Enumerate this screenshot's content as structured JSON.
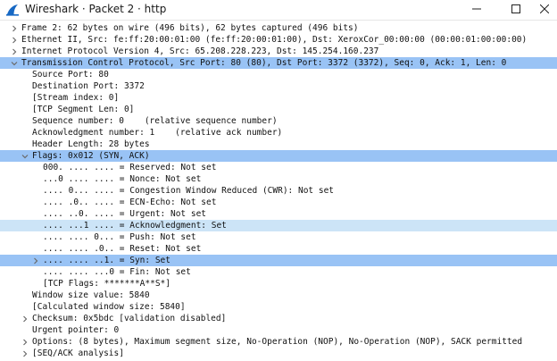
{
  "window": {
    "title": "Wireshark · Packet 2 · http",
    "controls": {
      "minimize": "–",
      "maximize": "□",
      "close": "✕"
    }
  },
  "colors": {
    "selected_row": "#99c3f5",
    "hover_row": "#cce4f7",
    "expander": "#6a6a6a",
    "wireshark_fin": "#1668c4"
  },
  "tree": [
    {
      "level": 0,
      "toggle": "collapsed",
      "text": "Frame 2: 62 bytes on wire (496 bits), 62 bytes captured (496 bits)"
    },
    {
      "level": 0,
      "toggle": "collapsed",
      "text": "Ethernet II, Src: fe:ff:20:00:01:00 (fe:ff:20:00:01:00), Dst: XeroxCor_00:00:00 (00:00:01:00:00:00)"
    },
    {
      "level": 0,
      "toggle": "collapsed",
      "text": "Internet Protocol Version 4, Src: 65.208.228.223, Dst: 145.254.160.237"
    },
    {
      "level": 0,
      "toggle": "expanded",
      "state": "selected",
      "text": "Transmission Control Protocol, Src Port: 80 (80), Dst Port: 3372 (3372), Seq: 0, Ack: 1, Len: 0"
    },
    {
      "level": 1,
      "toggle": "none",
      "text": "Source Port: 80"
    },
    {
      "level": 1,
      "toggle": "none",
      "text": "Destination Port: 3372"
    },
    {
      "level": 1,
      "toggle": "none",
      "text": "[Stream index: 0]"
    },
    {
      "level": 1,
      "toggle": "none",
      "text": "[TCP Segment Len: 0]"
    },
    {
      "level": 1,
      "toggle": "none",
      "text": "Sequence number: 0    (relative sequence number)"
    },
    {
      "level": 1,
      "toggle": "none",
      "text": "Acknowledgment number: 1    (relative ack number)"
    },
    {
      "level": 1,
      "toggle": "none",
      "text": "Header Length: 28 bytes"
    },
    {
      "level": 1,
      "toggle": "expanded",
      "state": "selected",
      "text": "Flags: 0x012 (SYN, ACK)"
    },
    {
      "level": 2,
      "toggle": "none",
      "text": "000. .... .... = Reserved: Not set"
    },
    {
      "level": 2,
      "toggle": "none",
      "text": "...0 .... .... = Nonce: Not set"
    },
    {
      "level": 2,
      "toggle": "none",
      "text": ".... 0... .... = Congestion Window Reduced (CWR): Not set"
    },
    {
      "level": 2,
      "toggle": "none",
      "text": ".... .0.. .... = ECN-Echo: Not set"
    },
    {
      "level": 2,
      "toggle": "none",
      "text": ".... ..0. .... = Urgent: Not set"
    },
    {
      "level": 2,
      "toggle": "none",
      "state": "hover",
      "text": ".... ...1 .... = Acknowledgment: Set"
    },
    {
      "level": 2,
      "toggle": "none",
      "text": ".... .... 0... = Push: Not set"
    },
    {
      "level": 2,
      "toggle": "none",
      "text": ".... .... .0.. = Reset: Not set"
    },
    {
      "level": 2,
      "toggle": "collapsed",
      "state": "selected",
      "text": ".... .... ..1. = Syn: Set"
    },
    {
      "level": 2,
      "toggle": "none",
      "text": ".... .... ...0 = Fin: Not set"
    },
    {
      "level": 2,
      "toggle": "none",
      "text": "[TCP Flags: *******A**S*]"
    },
    {
      "level": 1,
      "toggle": "none",
      "text": "Window size value: 5840"
    },
    {
      "level": 1,
      "toggle": "none",
      "text": "[Calculated window size: 5840]"
    },
    {
      "level": 1,
      "toggle": "collapsed",
      "text": "Checksum: 0x5bdc [validation disabled]"
    },
    {
      "level": 1,
      "toggle": "none",
      "text": "Urgent pointer: 0"
    },
    {
      "level": 1,
      "toggle": "collapsed",
      "text": "Options: (8 bytes), Maximum segment size, No-Operation (NOP), No-Operation (NOP), SACK permitted"
    },
    {
      "level": 1,
      "toggle": "collapsed",
      "text": "[SEQ/ACK analysis]"
    }
  ]
}
